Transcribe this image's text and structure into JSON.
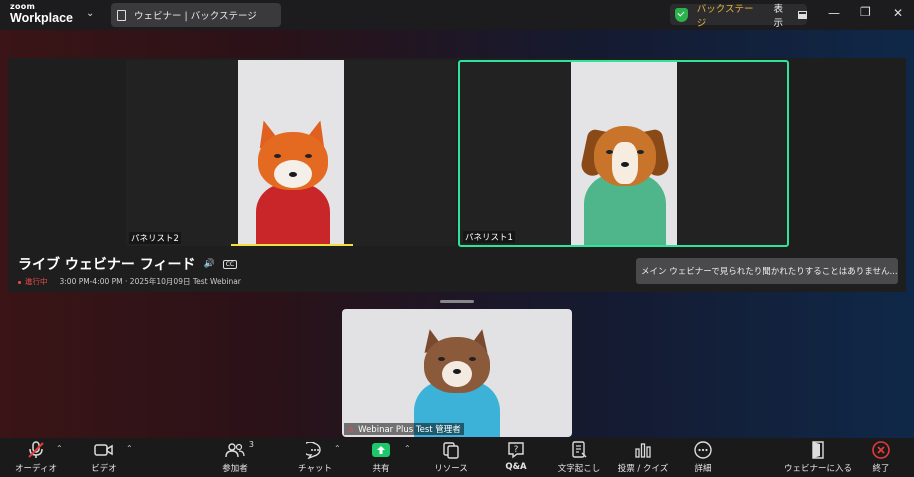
{
  "app": {
    "logo_top": "zoom",
    "logo_bottom": "Workplace"
  },
  "window_tab": {
    "title": "ウェビナー | バックステージ"
  },
  "status": {
    "backstage_label": "バックステージ",
    "view_label": "表示",
    "accent": "#2bb24c"
  },
  "stage": {
    "tiles": [
      {
        "label": "パネリスト2",
        "avatar": "fox"
      },
      {
        "label": "パネリスト1",
        "avatar": "dog",
        "active": true
      }
    ],
    "feed_title": "ライブ ウェビナー フィード",
    "status_live": "進行中",
    "meta": "3:00 PM-4:00 PM · 2025年10月09日 Test Webinar",
    "notice": "メイン ウェビナーで見られたり聞かれたりすることはありません..."
  },
  "self_view": {
    "label": "Webinar Plus Test 管理者",
    "avatar": "cat"
  },
  "toolbar": {
    "audio": {
      "label": "オーディオ",
      "icon": "mic-muted-icon"
    },
    "video": {
      "label": "ビデオ",
      "icon": "camera-icon"
    },
    "participants": {
      "label": "参加者",
      "count": "3",
      "icon": "people-icon"
    },
    "chat": {
      "label": "チャット",
      "icon": "chat-icon"
    },
    "share": {
      "label": "共有",
      "icon": "share-icon"
    },
    "resources": {
      "label": "リソース",
      "icon": "resources-icon"
    },
    "qa": {
      "label": "Q&A",
      "icon": "qa-icon"
    },
    "captions": {
      "label": "文字起こし",
      "icon": "captions-icon"
    },
    "polls": {
      "label": "投票 / クイズ",
      "icon": "poll-icon"
    },
    "more": {
      "label": "詳細",
      "icon": "more-icon"
    },
    "join_webinar": {
      "label": "ウェビナーに入る",
      "icon": "enter-door-icon"
    },
    "end": {
      "label": "終了",
      "icon": "end-icon"
    }
  }
}
